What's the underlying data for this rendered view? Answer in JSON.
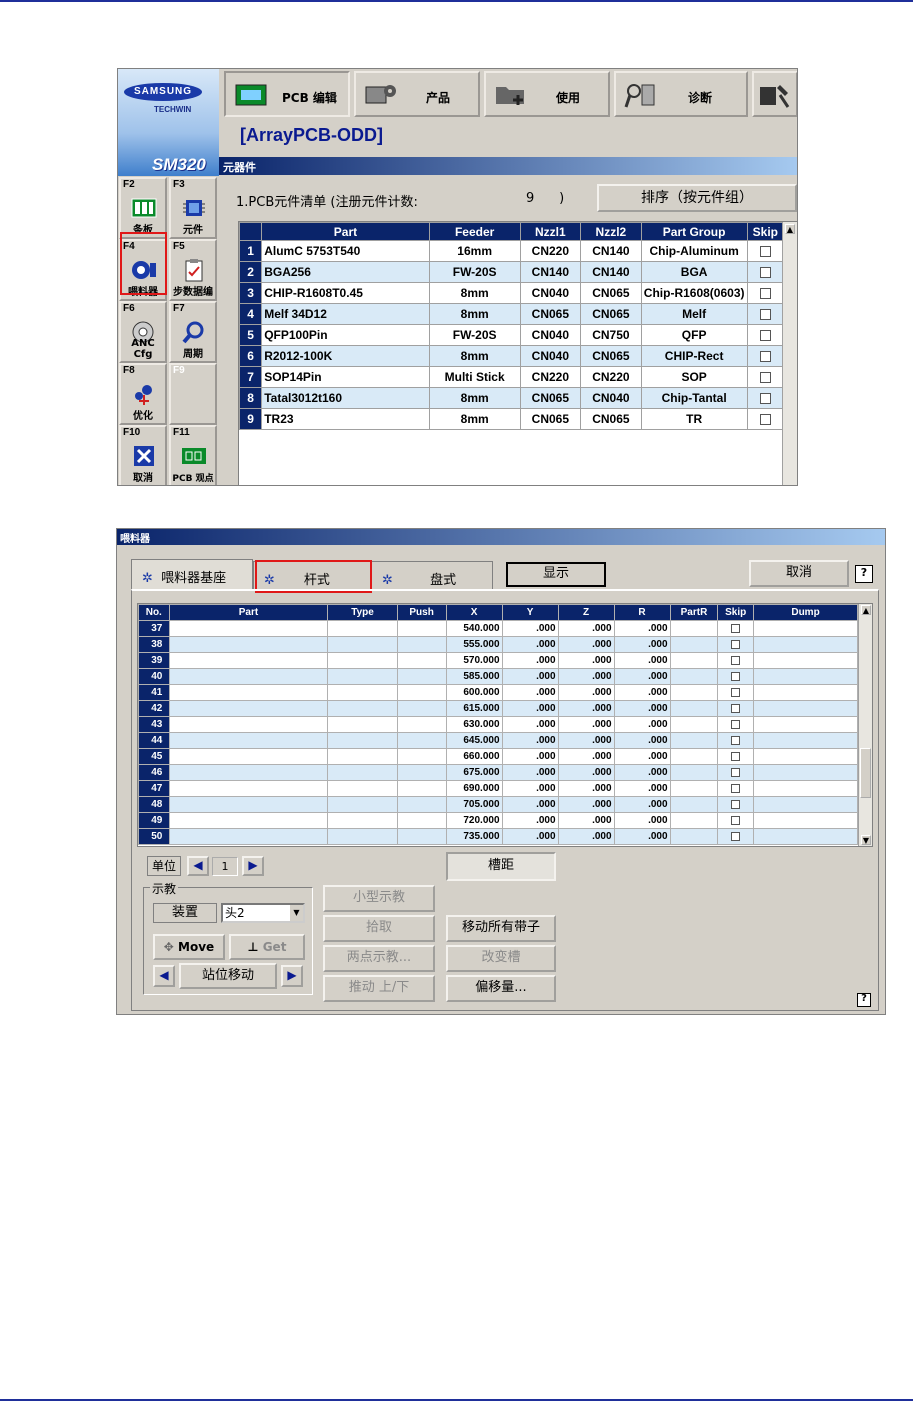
{
  "top_screen": {
    "brand": "SAMSUNG",
    "brand_sub": "TECHWIN",
    "model": "SM320",
    "toolbar": [
      {
        "label": "PCB 编辑"
      },
      {
        "label": "产品"
      },
      {
        "label": "使用"
      },
      {
        "label": "诊断"
      }
    ],
    "function_keys": [
      {
        "key": "F2",
        "label": "条板"
      },
      {
        "key": "F3",
        "label": "元件"
      },
      {
        "key": "F4",
        "label": "喂料器"
      },
      {
        "key": "F5",
        "label": "步数据编"
      },
      {
        "key": "F6",
        "label": "ANC Cfg"
      },
      {
        "key": "F7",
        "label": "周期"
      },
      {
        "key": "F8",
        "label": "优化"
      },
      {
        "key": "F9",
        "label": ""
      },
      {
        "key": "F10",
        "label": "取消"
      },
      {
        "key": "F11",
        "label": "PCB 观点"
      }
    ],
    "title": "[ArrayPCB-ODD]",
    "section": "元器件",
    "list_label": "1.PCB元件清单  (注册元件计数:",
    "count": "9",
    "count_close": ")",
    "sort_button": "排序（按元件组）",
    "columns": [
      "Part",
      "Feeder",
      "Nzzl1",
      "Nzzl2",
      "Part Group",
      "Skip"
    ],
    "rows": [
      {
        "no": "1",
        "part": "AlumC 5753T540",
        "feeder": "16mm",
        "n1": "CN220",
        "n2": "CN140",
        "group": "Chip-Aluminum"
      },
      {
        "no": "2",
        "part": "BGA256",
        "feeder": "FW-20S",
        "n1": "CN140",
        "n2": "CN140",
        "group": "BGA"
      },
      {
        "no": "3",
        "part": "CHIP-R1608T0.45",
        "feeder": "8mm",
        "n1": "CN040",
        "n2": "CN065",
        "group": "Chip-R1608(0603)"
      },
      {
        "no": "4",
        "part": "Melf 34D12",
        "feeder": "8mm",
        "n1": "CN065",
        "n2": "CN065",
        "group": "Melf"
      },
      {
        "no": "5",
        "part": "QFP100Pin",
        "feeder": "FW-20S",
        "n1": "CN040",
        "n2": "CN750",
        "group": "QFP"
      },
      {
        "no": "6",
        "part": "R2012-100K",
        "feeder": "8mm",
        "n1": "CN040",
        "n2": "CN065",
        "group": "CHIP-Rect"
      },
      {
        "no": "7",
        "part": "SOP14Pin",
        "feeder": "Multi Stick",
        "n1": "CN220",
        "n2": "CN220",
        "group": "SOP"
      },
      {
        "no": "8",
        "part": "Tatal3012t160",
        "feeder": "8mm",
        "n1": "CN065",
        "n2": "CN040",
        "group": "Chip-Tantal"
      },
      {
        "no": "9",
        "part": "TR23",
        "feeder": "8mm",
        "n1": "CN065",
        "n2": "CN065",
        "group": "TR"
      }
    ]
  },
  "feeder_dialog": {
    "title": "喂料器",
    "tabs": [
      "喂料器基座",
      "杆式",
      "盘式"
    ],
    "display_button": "显示",
    "cancel_button": "取消",
    "help": "?",
    "columns": [
      "No.",
      "Part",
      "Type",
      "Push",
      "X",
      "Y",
      "Z",
      "R",
      "PartR",
      "Skip",
      "Dump"
    ],
    "rows": [
      {
        "no": "37",
        "x": "540.000",
        "y": ".000",
        "z": ".000",
        "r": ".000"
      },
      {
        "no": "38",
        "x": "555.000",
        "y": ".000",
        "z": ".000",
        "r": ".000"
      },
      {
        "no": "39",
        "x": "570.000",
        "y": ".000",
        "z": ".000",
        "r": ".000"
      },
      {
        "no": "40",
        "x": "585.000",
        "y": ".000",
        "z": ".000",
        "r": ".000"
      },
      {
        "no": "41",
        "x": "600.000",
        "y": ".000",
        "z": ".000",
        "r": ".000"
      },
      {
        "no": "42",
        "x": "615.000",
        "y": ".000",
        "z": ".000",
        "r": ".000"
      },
      {
        "no": "43",
        "x": "630.000",
        "y": ".000",
        "z": ".000",
        "r": ".000"
      },
      {
        "no": "44",
        "x": "645.000",
        "y": ".000",
        "z": ".000",
        "r": ".000"
      },
      {
        "no": "45",
        "x": "660.000",
        "y": ".000",
        "z": ".000",
        "r": ".000"
      },
      {
        "no": "46",
        "x": "675.000",
        "y": ".000",
        "z": ".000",
        "r": ".000"
      },
      {
        "no": "47",
        "x": "690.000",
        "y": ".000",
        "z": ".000",
        "r": ".000"
      },
      {
        "no": "48",
        "x": "705.000",
        "y": ".000",
        "z": ".000",
        "r": ".000"
      },
      {
        "no": "49",
        "x": "720.000",
        "y": ".000",
        "z": ".000",
        "r": ".000"
      },
      {
        "no": "50",
        "x": "735.000",
        "y": ".000",
        "z": ".000",
        "r": ".000"
      }
    ],
    "unit_label": "单位",
    "page": "1",
    "pitch_button": "槽距",
    "teach_group": "示教",
    "device_label": "装置",
    "device_value": "头2",
    "move_button": "Move",
    "get_button": "Get",
    "station_move": "站位移动",
    "small_teach": "小型示教",
    "pickup": "拾取",
    "two_point": "两点示教...",
    "push_updown": "推动 上/下",
    "move_all": "移动所有带子",
    "change_slot": "改变槽",
    "offset": "偏移量..."
  },
  "colors": {
    "accent_red": "#e01818",
    "header_blue": "#0a246a",
    "row_alt": "#d9eaf7"
  }
}
